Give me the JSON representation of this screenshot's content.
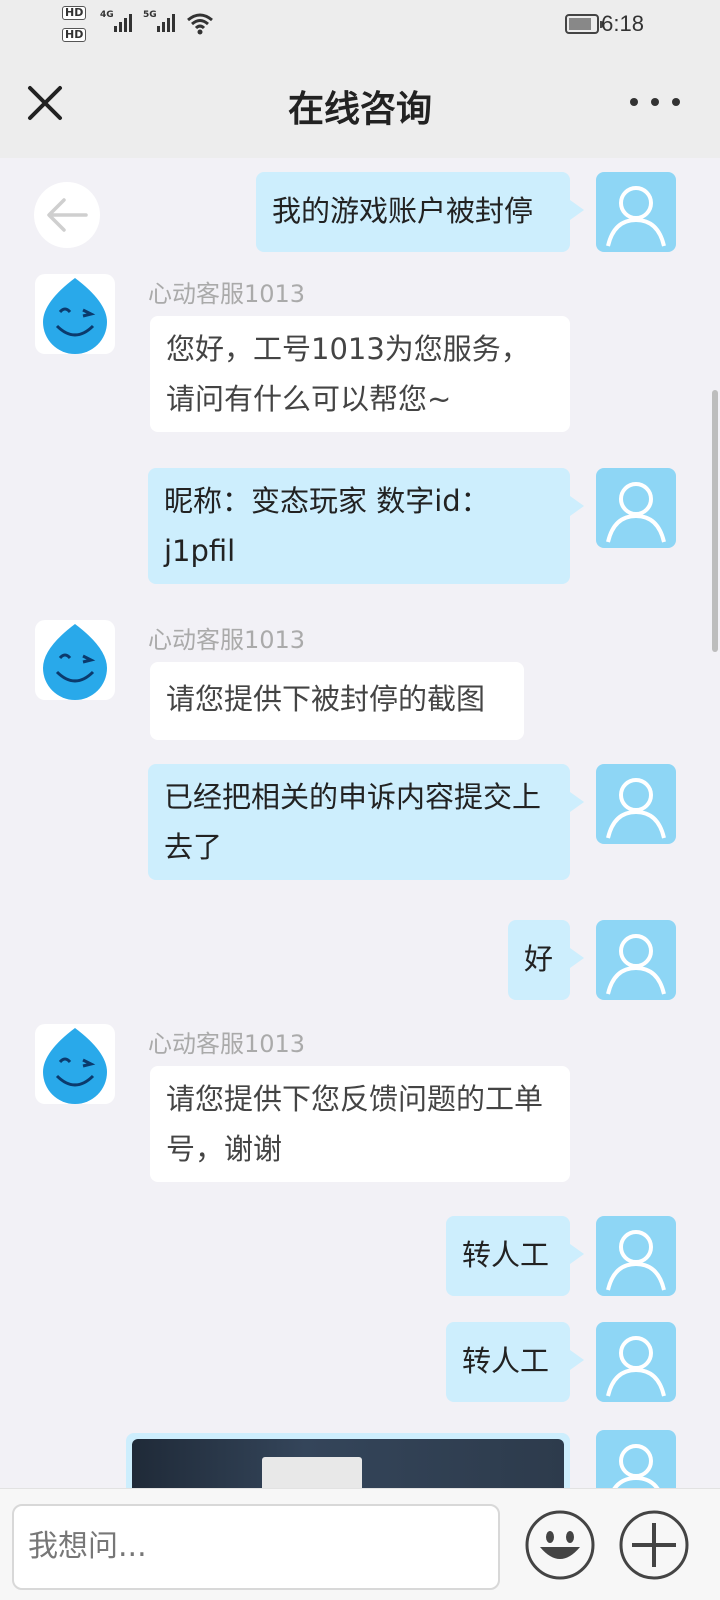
{
  "status_bar": {
    "hd1": "HD",
    "hd2": "HD",
    "net1": "4G",
    "net2": "5G",
    "time": "6:18"
  },
  "header": {
    "title": "在线咨询"
  },
  "messages": {
    "m1": "我的游戏账户被封停",
    "agent_name": "心动客服1013",
    "m2": "您好，工号1013为您服务，请问有什么可以帮您~",
    "m3": "昵称：变态玩家 数字id：j1pfil",
    "m4": "请您提供下被封停的截图",
    "m5": "已经把相关的申诉内容提交上去了",
    "m6": "好",
    "m7": "请您提供下您反馈问题的工单号，谢谢",
    "m8": "转人工",
    "m9": "转人工"
  },
  "input": {
    "placeholder": "我想问..."
  },
  "colors": {
    "user_bubble": "#cdeefd",
    "agent_bubble": "#ffffff",
    "user_avatar": "#8ed6f5",
    "background": "#f2f1f6"
  },
  "icons": [
    "close-icon",
    "more-icon",
    "back-arrow-icon",
    "user-avatar-icon",
    "agent-avatar-icon",
    "emoji-icon",
    "plus-icon"
  ]
}
